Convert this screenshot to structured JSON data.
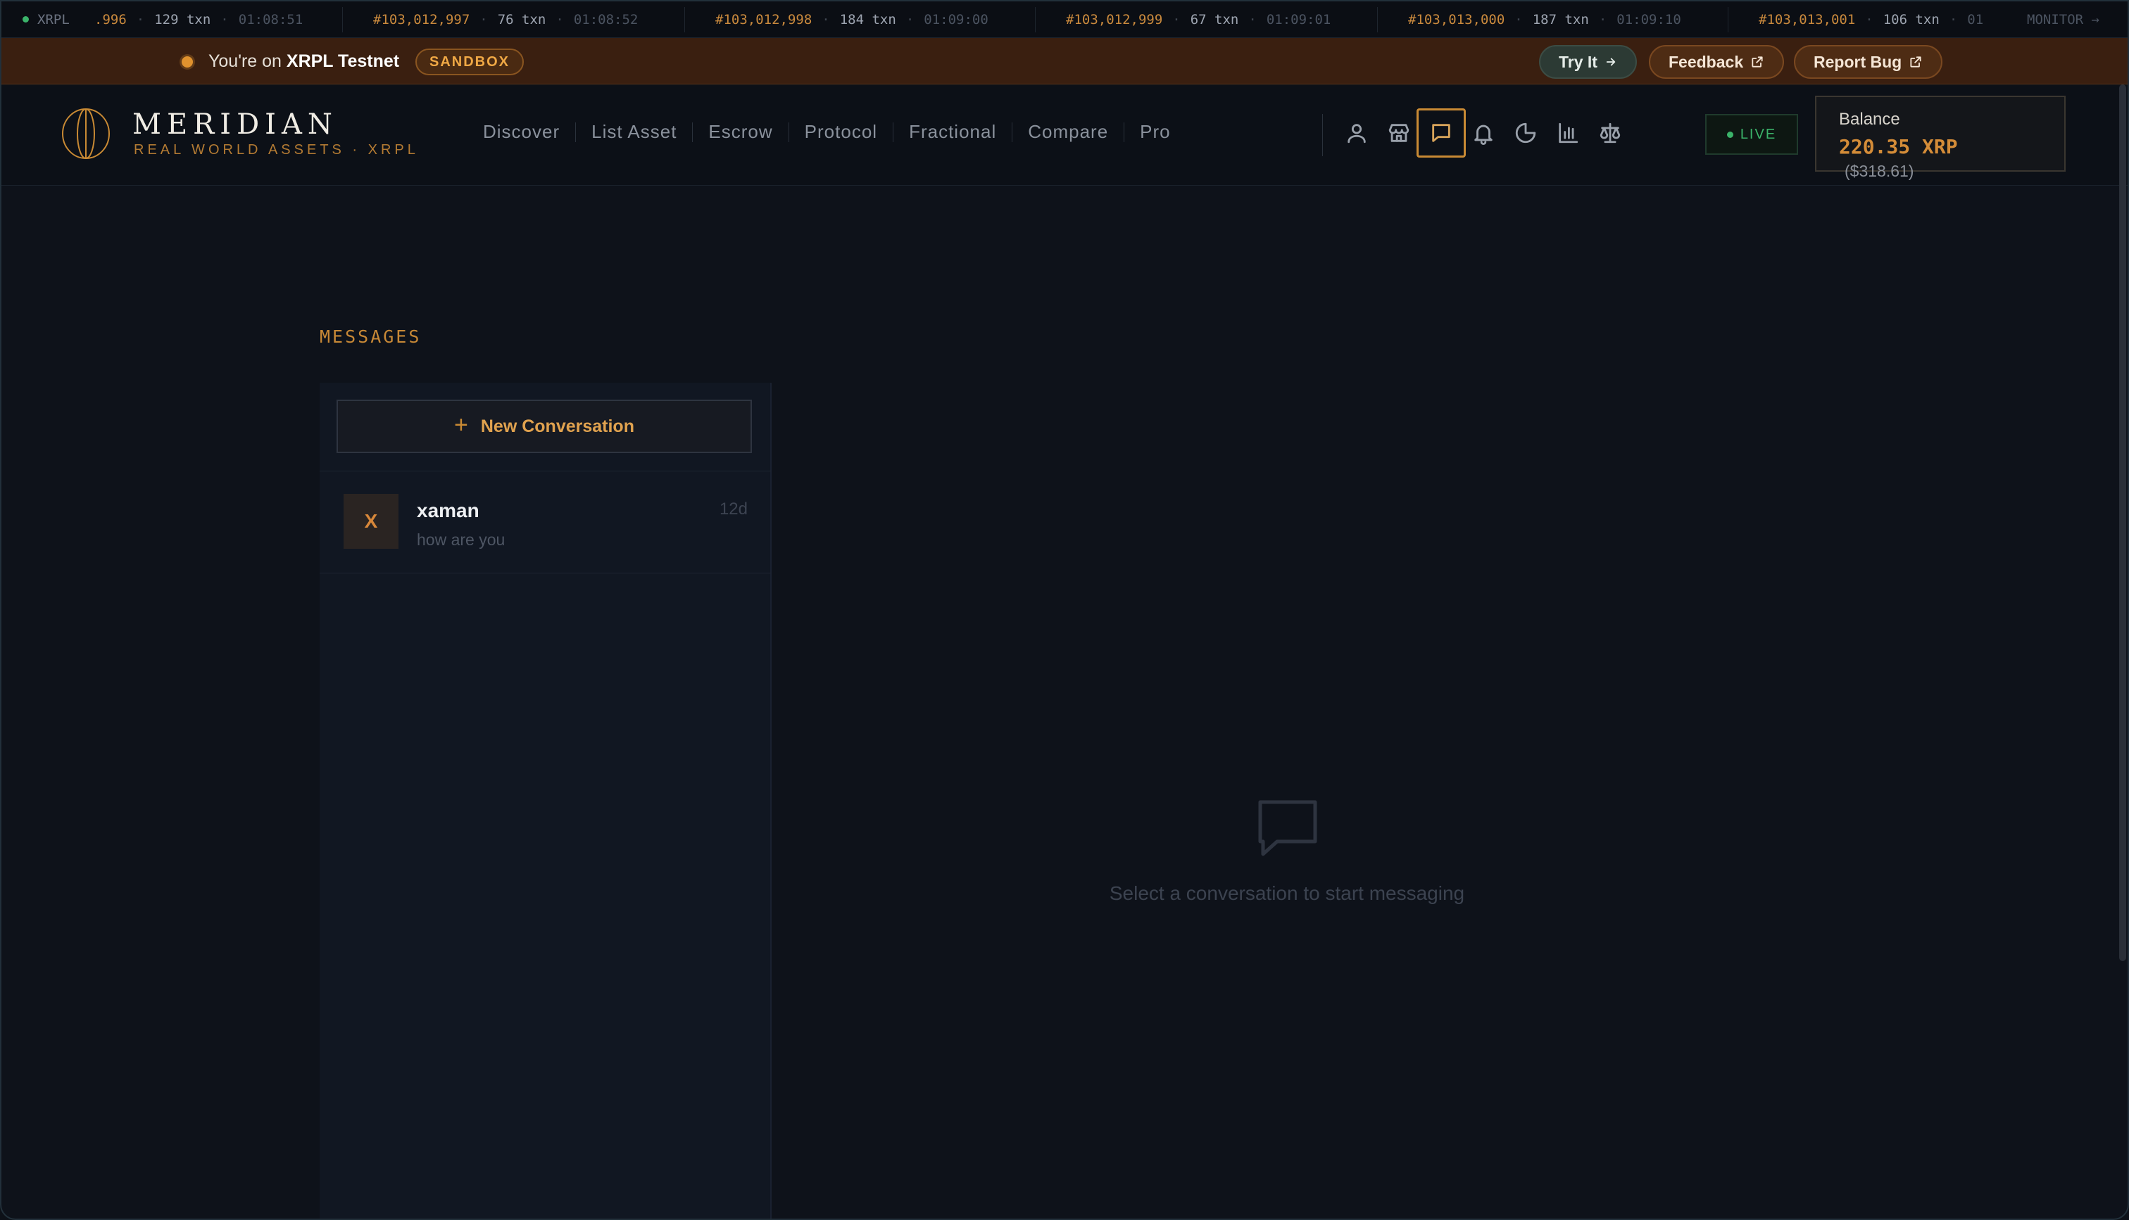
{
  "ticker": {
    "network": "XRPL",
    "monitor": "MONITOR →",
    "items": [
      {
        "ledger": ".996",
        "txn": "129 txn",
        "time": "01:08:51"
      },
      {
        "ledger": "#103,012,997",
        "txn": "76 txn",
        "time": "01:08:52"
      },
      {
        "ledger": "#103,012,998",
        "txn": "184 txn",
        "time": "01:09:00"
      },
      {
        "ledger": "#103,012,999",
        "txn": "67 txn",
        "time": "01:09:01"
      },
      {
        "ledger": "#103,013,000",
        "txn": "187 txn",
        "time": "01:09:10"
      },
      {
        "ledger": "#103,013,001",
        "txn": "106 txn",
        "time": "01"
      }
    ]
  },
  "banner": {
    "prefix": "You're on ",
    "network": "XRPL Testnet",
    "badge": "SANDBOX",
    "try_it": "Try It",
    "feedback": "Feedback",
    "report_bug": "Report Bug"
  },
  "header": {
    "brand": "MERIDIAN",
    "subtitle": "REAL WORLD ASSETS · XRPL",
    "nav": [
      "Discover",
      "List Asset",
      "Escrow",
      "Protocol",
      "Fractional",
      "Compare",
      "Pro"
    ],
    "icons": [
      "user-icon",
      "storefront-icon",
      "message-icon",
      "bell-icon",
      "pie-chart-icon",
      "bar-chart-icon",
      "scales-icon"
    ],
    "active_icon": "message-icon",
    "live": "LIVE",
    "balance_label": "Balance",
    "balance_amount": "220.35 XRP",
    "balance_usd": "($318.61)"
  },
  "messages": {
    "title": "MESSAGES",
    "new_conversation": "New Conversation",
    "conversations": [
      {
        "initial": "X",
        "name": "xaman",
        "preview": "how are you",
        "age": "12d"
      }
    ],
    "empty_state": "Select a conversation to start messaging"
  },
  "colors": {
    "accent": "#c98a34",
    "live_green": "#3bb36a",
    "banner_bg": "#3a1f10",
    "page_bg": "#0e121a"
  }
}
